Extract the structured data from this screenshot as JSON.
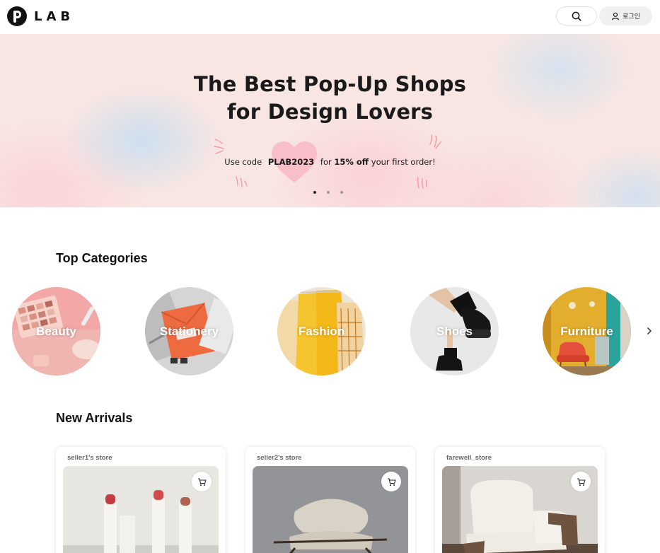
{
  "header": {
    "logo_text": "LAB",
    "login_label": "로그인"
  },
  "banner": {
    "title_line1": "The Best Pop-Up Shops",
    "title_line2": "for Design Lovers",
    "promo_prefix": "Use code",
    "promo_code": "PLAB2023",
    "promo_mid": "for",
    "promo_bold": "15% off",
    "promo_suffix": "your first order!",
    "slide_count": 3,
    "active_slide": 1
  },
  "categories": {
    "title": "Top Categories",
    "items": [
      {
        "label": "Beauty"
      },
      {
        "label": "Stationery"
      },
      {
        "label": "Fashion"
      },
      {
        "label": "Shoes"
      },
      {
        "label": "Furniture"
      }
    ]
  },
  "new_arrivals": {
    "title": "New Arrivals",
    "products": [
      {
        "store": "seller1's store"
      },
      {
        "store": "seller2's store"
      },
      {
        "store": "farewell_store"
      }
    ]
  }
}
